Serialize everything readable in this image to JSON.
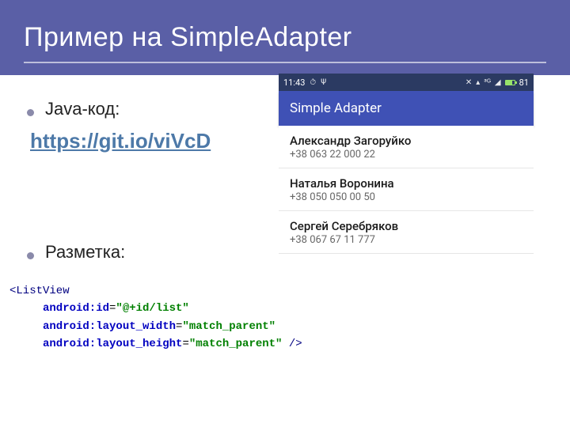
{
  "slide": {
    "title": "Пример на SimpleAdapter",
    "bullets": [
      "Java-код:",
      "Разметка:"
    ],
    "java_link": "https://git.io/viVcD"
  },
  "phone": {
    "statusbar": {
      "time": "11:43",
      "battery_percent": "81"
    },
    "appbar_title": "Simple Adapter",
    "contacts": [
      {
        "name": "Александр Загоруйко",
        "phone": "+38 063 22 000 22"
      },
      {
        "name": "Наталья Воронина",
        "phone": "+38 050 050 00 50"
      },
      {
        "name": "Сергей Серебряков",
        "phone": "+38 067 67 11 777"
      }
    ]
  },
  "code": {
    "tag_open": "<ListView",
    "attr_id": "android:id",
    "val_id": "\"@+id/list\"",
    "attr_w": "android:layout_width",
    "val_w": "\"match_parent\"",
    "attr_h": "android:layout_height",
    "val_h": "\"match_parent\"",
    "tag_close": " />"
  }
}
